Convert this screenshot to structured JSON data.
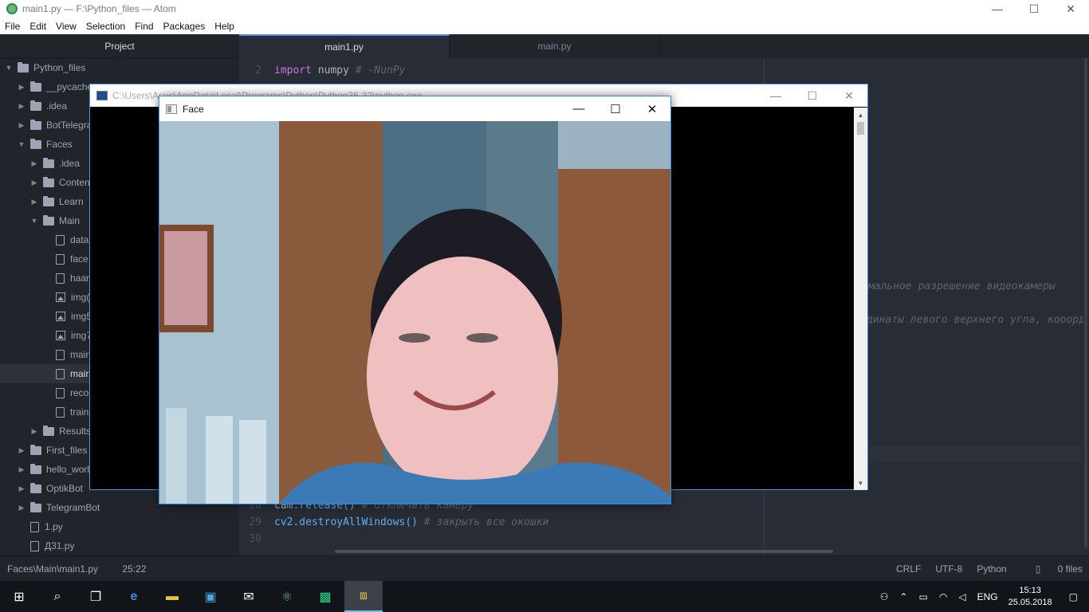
{
  "window": {
    "title": "main1.py — F:\\Python_files — Atom",
    "minimize": "—",
    "maximize": "☐",
    "close": "✕"
  },
  "menu": [
    "File",
    "Edit",
    "View",
    "Selection",
    "Find",
    "Packages",
    "Help"
  ],
  "tree": {
    "header": "Project",
    "items": [
      {
        "label": "Python_files",
        "type": "folder",
        "depth": 0,
        "open": true
      },
      {
        "label": "__pycache_",
        "type": "folder",
        "depth": 1,
        "open": false
      },
      {
        "label": ".idea",
        "type": "folder",
        "depth": 1,
        "open": false
      },
      {
        "label": "BotTelegra",
        "type": "folder",
        "depth": 1,
        "open": false
      },
      {
        "label": "Faces",
        "type": "folder",
        "depth": 1,
        "open": true
      },
      {
        "label": ".idea",
        "type": "folder",
        "depth": 2,
        "open": false
      },
      {
        "label": "Conten",
        "type": "folder",
        "depth": 2,
        "open": false
      },
      {
        "label": "Learn",
        "type": "folder",
        "depth": 2,
        "open": false
      },
      {
        "label": "Main",
        "type": "folder",
        "depth": 2,
        "open": true
      },
      {
        "label": "data",
        "type": "file",
        "depth": 3
      },
      {
        "label": "face",
        "type": "file",
        "depth": 3
      },
      {
        "label": "haar",
        "type": "file",
        "depth": 3
      },
      {
        "label": "img(",
        "type": "image",
        "depth": 3
      },
      {
        "label": "img5",
        "type": "image",
        "depth": 3
      },
      {
        "label": "img7",
        "type": "image",
        "depth": 3
      },
      {
        "label": "mair",
        "type": "file",
        "depth": 3
      },
      {
        "label": "mair",
        "type": "file",
        "depth": 3,
        "selected": true
      },
      {
        "label": "reco",
        "type": "file",
        "depth": 3
      },
      {
        "label": "train",
        "type": "file",
        "depth": 3
      },
      {
        "label": "Results",
        "type": "folder",
        "depth": 2,
        "open": false
      },
      {
        "label": "First_files",
        "type": "folder",
        "depth": 1,
        "open": false
      },
      {
        "label": "hello_world",
        "type": "folder",
        "depth": 1,
        "open": false
      },
      {
        "label": "OptikBot",
        "type": "folder",
        "depth": 1,
        "open": false
      },
      {
        "label": "TelegramBot",
        "type": "folder",
        "depth": 1,
        "open": false
      },
      {
        "label": "1.py",
        "type": "file",
        "depth": 1
      },
      {
        "label": "Д31.py",
        "type": "file",
        "depth": 1
      }
    ]
  },
  "tabs": [
    {
      "label": "main1.py",
      "active": true
    },
    {
      "label": "main.py",
      "active": false
    }
  ],
  "code": {
    "line2": {
      "num": "2",
      "kw": "import",
      "id": "numpy",
      "comment": "# -NunPy"
    },
    "line28": {
      "num": "28",
      "obj": "cam",
      "call": ".release()",
      "comment": "# отключить камеру"
    },
    "line29": {
      "num": "29",
      "fn": "cv2.destroyAllWindows()",
      "comment": "# закрыть все окошки"
    },
    "line30": {
      "num": "30"
    },
    "side1": "имальное разрешение видеокамеры",
    "side2": "динаты левого верхнего угла, кооорд"
  },
  "console": {
    "title": "C:\\Users\\Asus\\AppData\\Local\\Programs\\Python\\Python36-32\\python.exe"
  },
  "face_window": {
    "title": "Face"
  },
  "statusbar": {
    "path": "Faces\\Main\\main1.py",
    "position": "25:22",
    "line_ending": "CRLF",
    "encoding": "UTF-8",
    "grammar": "Python",
    "files": "0 files"
  },
  "taskbar": {
    "lang": "ENG",
    "time": "15:13",
    "date": "25.05.2018"
  }
}
